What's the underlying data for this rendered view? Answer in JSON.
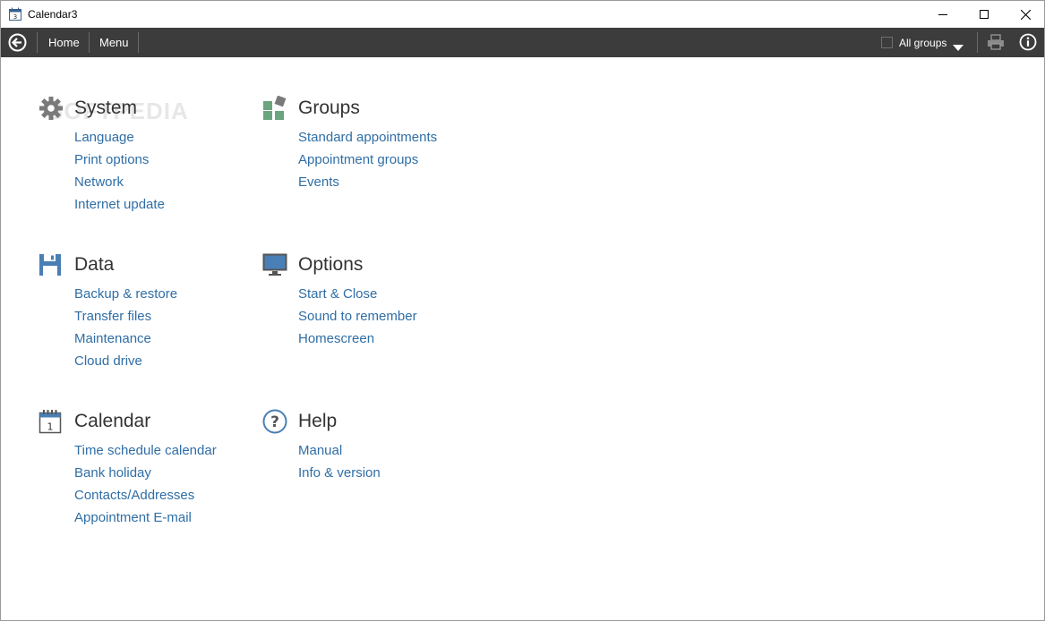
{
  "window": {
    "title": "Calendar3"
  },
  "toolbar": {
    "home_label": "Home",
    "menu_label": "Menu",
    "groups_label": "All groups"
  },
  "sections": {
    "system": {
      "title": "System",
      "links": [
        "Language",
        "Print options",
        "Network",
        "Internet update"
      ]
    },
    "groups": {
      "title": "Groups",
      "links": [
        "Standard appointments",
        "Appointment groups",
        "Events"
      ]
    },
    "data": {
      "title": "Data",
      "links": [
        "Backup & restore",
        "Transfer files",
        "Maintenance",
        "Cloud drive"
      ]
    },
    "options": {
      "title": "Options",
      "links": [
        "Start & Close",
        "Sound to remember",
        "Homescreen"
      ]
    },
    "calendar": {
      "title": "Calendar",
      "links": [
        "Time schedule calendar",
        "Bank holiday",
        "Contacts/Addresses",
        "Appointment E-mail"
      ]
    },
    "help": {
      "title": "Help",
      "links": [
        "Manual",
        "Info & version"
      ]
    }
  },
  "colors": {
    "toolbar_bg": "#3c3c3c",
    "link": "#2f6ea6",
    "heading": "#333333",
    "icon_blue": "#4a7fb5",
    "icon_green": "#6aa57f",
    "icon_gray": "#7a7a7a"
  },
  "icons": {
    "system": "gear-icon",
    "groups": "groups-icon",
    "data": "floppy-disk-icon",
    "options": "monitor-icon",
    "calendar": "calendar-icon",
    "help": "question-icon"
  }
}
